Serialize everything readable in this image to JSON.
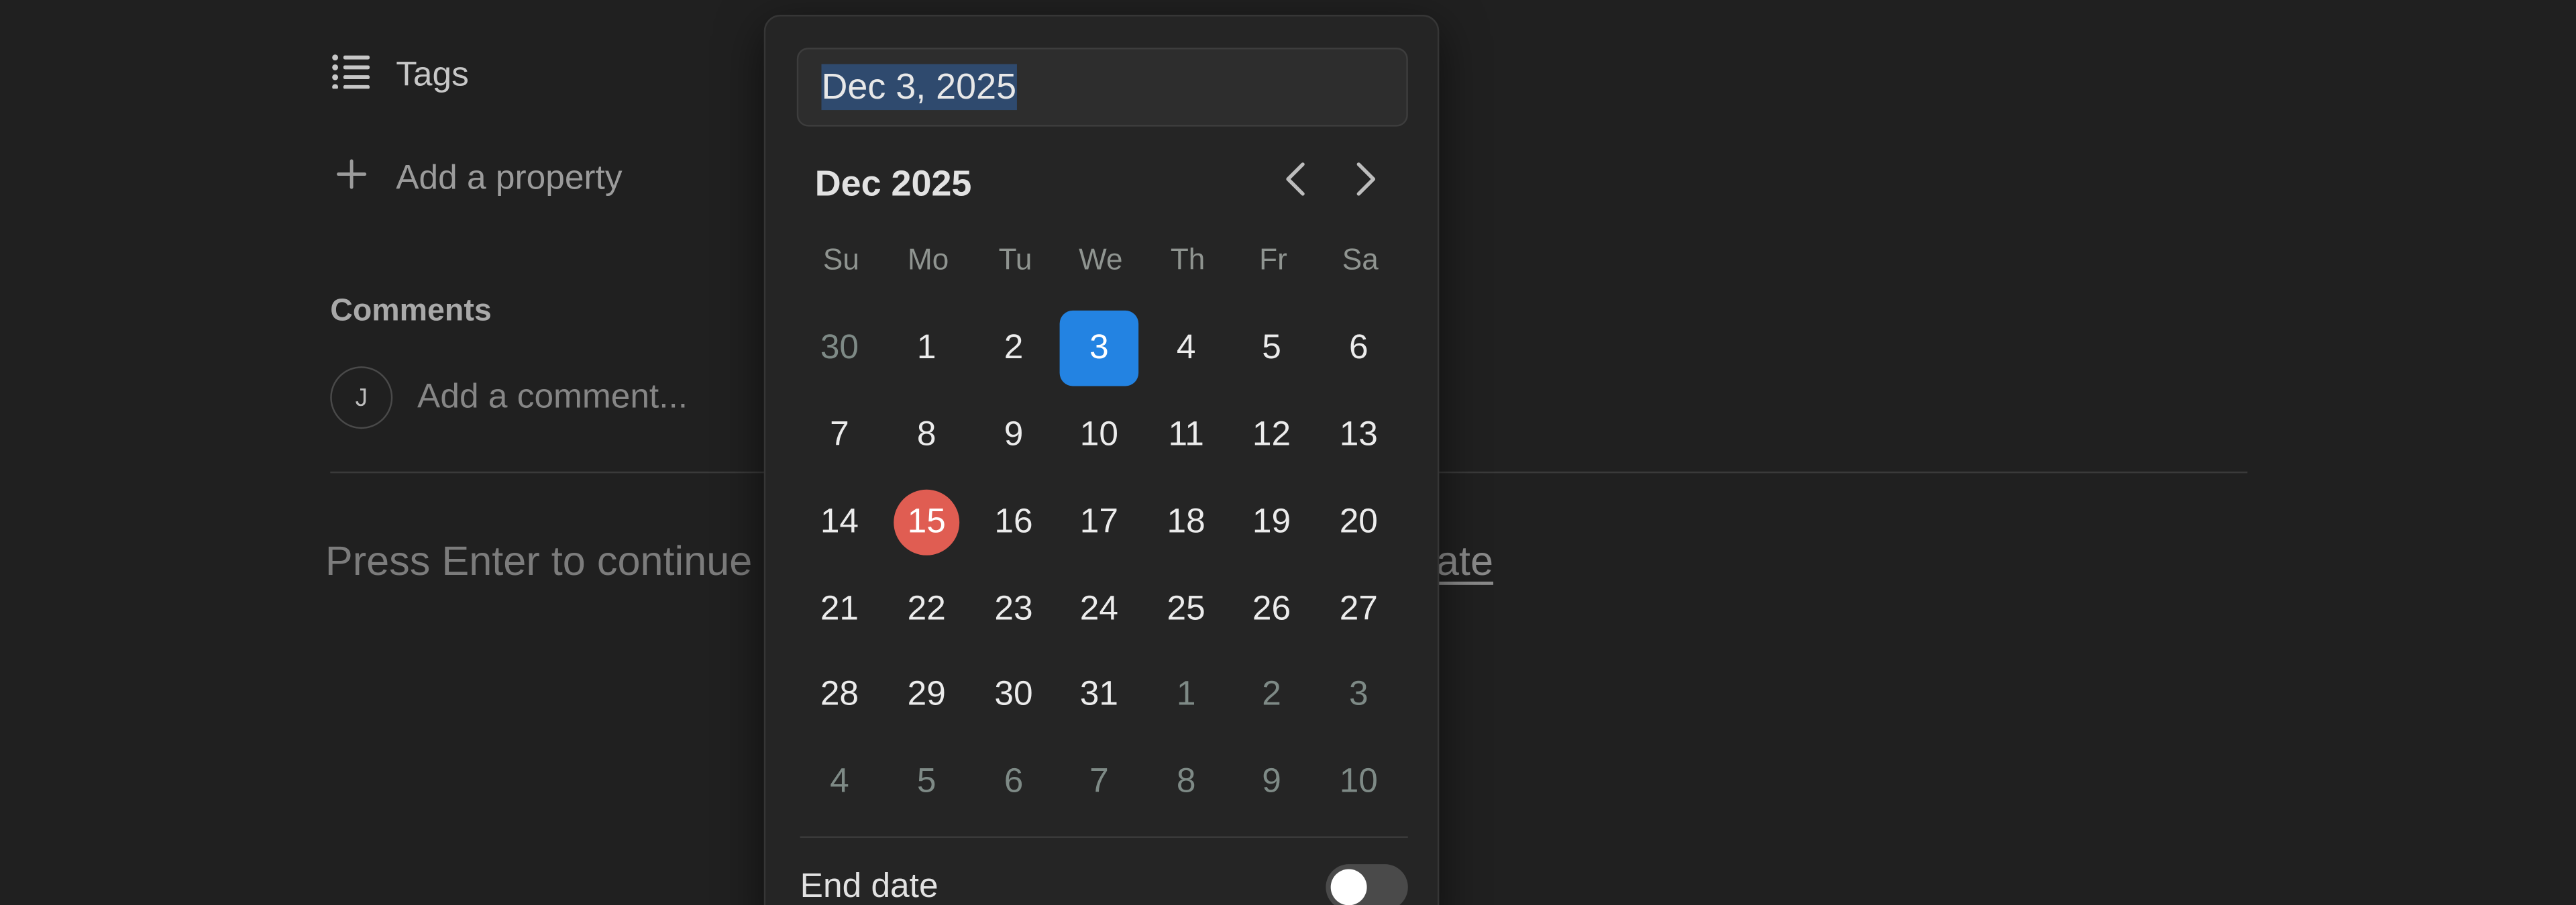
{
  "properties": {
    "tags_label": "Tags",
    "add_property_label": "Add a property"
  },
  "comments": {
    "heading": "Comments",
    "avatar_initial": "J",
    "placeholder": "Add a comment..."
  },
  "footer": {
    "hint_text": "Press Enter to continue",
    "link_text": "emplate"
  },
  "date_picker": {
    "input_value": "Dec 3, 2025",
    "month_label": "Dec 2025",
    "weekdays": [
      "Su",
      "Mo",
      "Tu",
      "We",
      "Th",
      "Fr",
      "Sa"
    ],
    "weeks": [
      [
        "30",
        "1",
        "2",
        "3",
        "4",
        "5",
        "6"
      ],
      [
        "7",
        "8",
        "9",
        "10",
        "11",
        "12",
        "13"
      ],
      [
        "14",
        "15",
        "16",
        "17",
        "18",
        "19",
        "20"
      ],
      [
        "21",
        "22",
        "23",
        "24",
        "25",
        "26",
        "27"
      ],
      [
        "28",
        "29",
        "30",
        "31",
        "1",
        "2",
        "3"
      ],
      [
        "4",
        "5",
        "6",
        "7",
        "8",
        "9",
        "10"
      ]
    ],
    "selected_day": "3",
    "today_day": "15",
    "end_date_label": "End date",
    "end_date_enabled": false,
    "colors": {
      "selected": "#2383e2",
      "today": "#e05d52"
    }
  },
  "icons": {
    "tags": "list-icon",
    "add_property": "plus-icon",
    "prev": "chevron-left-icon",
    "next": "chevron-right-icon"
  }
}
